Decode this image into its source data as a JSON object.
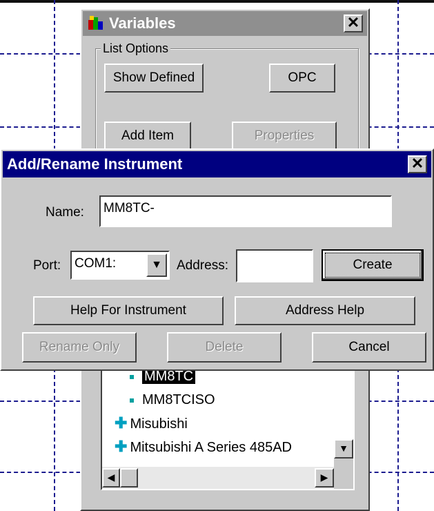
{
  "variables_window": {
    "title": "Variables",
    "group_label": "List Options",
    "buttons": {
      "show_defined": "Show Defined",
      "opc": "OPC",
      "add_item": "Add Item",
      "properties": "Properties"
    },
    "tree_items": [
      {
        "label": "MM8TC",
        "type": "leaf",
        "selected": true
      },
      {
        "label": "MM8TCISO",
        "type": "leaf"
      },
      {
        "label": "Misubishi",
        "type": "group"
      },
      {
        "label": "Mitsubishi A Series 485AD",
        "type": "group"
      }
    ]
  },
  "dialog": {
    "title": "Add/Rename Instrument",
    "name_label": "Name:",
    "name_value": "MM8TC-",
    "port_label": "Port:",
    "port_value": "COM1:",
    "address_label": "Address:",
    "address_value": "",
    "buttons": {
      "create": "Create",
      "help_for_instrument": "Help For Instrument",
      "address_help": "Address Help",
      "rename_only": "Rename Only",
      "delete": "Delete",
      "cancel": "Cancel"
    }
  },
  "icons": {
    "close": "close-icon",
    "app": "app-icon",
    "dropdown": "chevron-down-icon"
  },
  "colors": {
    "dialog_title_bg": "#000080",
    "inactive_title_bg": "#8f8f8f",
    "face": "#c9c9c9"
  }
}
